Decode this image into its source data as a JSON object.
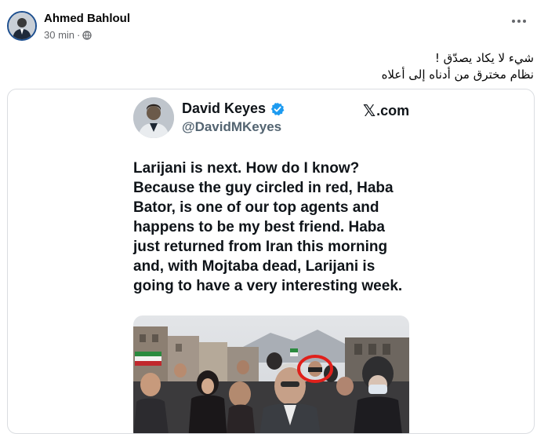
{
  "post": {
    "author": "Ahmed Bahloul",
    "time": "30 min",
    "separator": "·",
    "caption_line1": "شيء لا يكاد يصدّق !",
    "caption_line2": "نظام مخترق من أدناه إلى أعلاه"
  },
  "tweet": {
    "name": "David Keyes",
    "handle": "@DavidMKeyes",
    "platform_mark": "𝕏",
    "platform_suffix": ".com",
    "text": "Larijani is next. How do I know? Because the guy circled in red, Haba Bator, is one of our top agents and happens to be my best friend. Haba just returned from Iran this morning and, with Mojtaba dead, Larijani is going to have a very interesting week.",
    "highlight_color": "#e0201b"
  },
  "icons": [
    "globe-icon",
    "more-options-icon",
    "verified-badge-icon",
    "x-logo-icon"
  ],
  "colors": {
    "verified_blue": "#1d9bf0",
    "meta_gray": "#65676b",
    "handle_gray": "#536471"
  }
}
